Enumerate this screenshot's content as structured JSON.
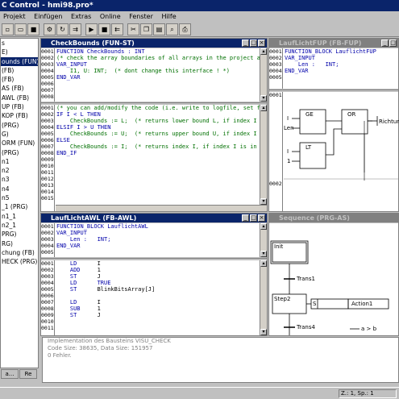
{
  "window": {
    "title": "C Control - hmi98.pro*"
  },
  "menu": [
    "Projekt",
    "Einfügen",
    "Extras",
    "Online",
    "Fenster",
    "Hilfe"
  ],
  "toolbar": [
    "new",
    "open",
    "save",
    "build",
    "rebuild",
    "login",
    "logout",
    "run",
    "stop",
    "cut",
    "copy",
    "paste",
    "find",
    "print"
  ],
  "tree": {
    "items": [
      "s",
      "E)",
      "ounds (FUN)",
      "(FB)",
      "(FB)",
      "AS (FB)",
      "AWL (FB)",
      "UP (FB)",
      "KOP (FB)",
      "(PRG)",
      "G)",
      "ORM (FUN)",
      "(PRG)",
      "n1",
      "n2",
      "n3",
      "n4",
      "n5",
      "_1 (PRG)",
      "n1_1",
      "n2_1",
      "PRG)",
      "RG)",
      "chung (FB)",
      "HECK (PRG)"
    ],
    "selected_index": 2,
    "tabs": [
      "a...",
      "Re"
    ]
  },
  "checkbounds": {
    "title": "CheckBounds (FUN-ST)",
    "decl_lines": [
      "0001",
      "0002",
      "0003",
      "0004",
      "0005",
      "0006",
      "0007",
      "0008"
    ],
    "decl_code": [
      {
        "t": "FUNCTION CheckBounds : INT",
        "c": "blue"
      },
      {
        "t": "(* check the array boundaries of all arrays in the project automatically *)",
        "c": "green"
      },
      {
        "t": "VAR_INPUT",
        "c": "blue"
      },
      {
        "t": "    I1, U: INT;  (* dont change this interface ! *)",
        "c": "green"
      },
      {
        "t": "END_VAR",
        "c": "blue"
      }
    ],
    "body_lines": [
      "0001",
      "0002",
      "0003",
      "0004",
      "0005",
      "0006",
      "0007",
      "0008",
      "0009",
      "0010",
      "0011",
      "0012",
      "0013",
      "0014",
      "0015"
    ],
    "body_code": [
      {
        "t": "(* you can add/modify the code (i.e. write to logfile, set flag *)",
        "c": "green"
      },
      {
        "t": "IF I < L THEN",
        "c": "blue"
      },
      {
        "t": "    CheckBounds := L;  (* returns lower bound L, if index I is lower than low",
        "c": "green"
      },
      {
        "t": "ELSIF I > U THEN",
        "c": "blue"
      },
      {
        "t": "    CheckBounds := U;  (* returns upper bound U, if index I is greater than u",
        "c": "green"
      },
      {
        "t": "ELSE",
        "c": "blue"
      },
      {
        "t": "    CheckBounds := I;  (* returns index I, if index I is in the bounds *)",
        "c": "green"
      },
      {
        "t": "END_IF",
        "c": "blue"
      }
    ]
  },
  "lauflichtfup": {
    "title": "LaufLichtFUP (FB-FUP)",
    "decl_lines": [
      "0001",
      "0002",
      "0003",
      "0004",
      "0005"
    ],
    "decl_code": [
      {
        "t": "FUNCTION_BLOCK LauflichtFUP",
        "c": "blue"
      },
      {
        "t": "VAR_INPUT",
        "c": "blue"
      },
      {
        "t": "    Len :   INT;",
        "c": "blue"
      },
      {
        "t": "END_VAR",
        "c": "blue"
      }
    ],
    "net_labels": [
      "0001",
      "0002"
    ],
    "blocks": {
      "ge": "GE",
      "or": "OR",
      "lt": "LT"
    },
    "inputs": [
      "I",
      "Len",
      "I",
      "1"
    ],
    "output": "Richtung"
  },
  "lauflichtawl": {
    "title": "LaufLichtAWL (FB-AWL)",
    "decl_lines": [
      "0001",
      "0002",
      "0003",
      "0004",
      "0005"
    ],
    "decl_code": [
      {
        "t": "FUNCTION_BLOCK LauflichtAWL",
        "c": "blue"
      },
      {
        "t": "VAR_INPUT",
        "c": "blue"
      },
      {
        "t": "    Len :   INT;",
        "c": "blue"
      },
      {
        "t": "END_VAR",
        "c": "blue"
      }
    ],
    "body_lines": [
      "0001",
      "0002",
      "0003",
      "0004",
      "0005",
      "0006",
      "0007",
      "0008",
      "0009",
      "0010",
      "0011"
    ],
    "body_code": [
      {
        "op": "LD",
        "arg": "I"
      },
      {
        "op": "ADD",
        "arg": "1"
      },
      {
        "op": "ST",
        "arg": "J"
      },
      {
        "op": "LD",
        "arg": "TRUE"
      },
      {
        "op": "ST",
        "arg": "BlinkBitsArray[J]"
      },
      {
        "op": "",
        "arg": ""
      },
      {
        "op": "LD",
        "arg": "I"
      },
      {
        "op": "SUB",
        "arg": "1"
      },
      {
        "op": "ST",
        "arg": "J"
      }
    ]
  },
  "sequence": {
    "title": "Sequence (PRG-AS)",
    "init": "Init",
    "trans1": "Trans1",
    "step2": "Step2",
    "qualifier": "S",
    "action": "Action1",
    "trans4": "Trans4",
    "cond": "a > b"
  },
  "messages": [
    "Implementation des Bausteins VISU_CHECK",
    "Code Size: 38635, Data Size: 151957",
    "0 Fehler."
  ],
  "status": {
    "pos": "Z.: 1, Sp.: 1"
  }
}
